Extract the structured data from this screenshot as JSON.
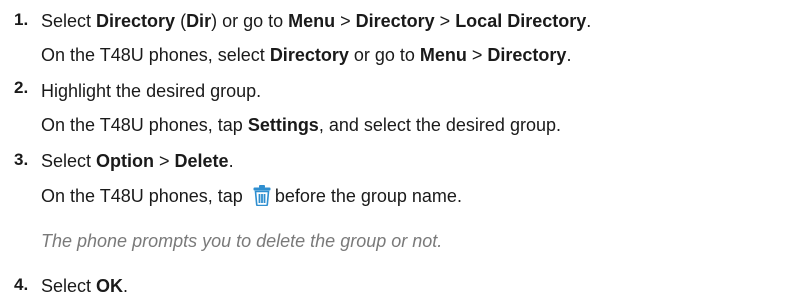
{
  "steps": [
    {
      "number": "1.",
      "line1": {
        "t1": "Select ",
        "b1": "Directory",
        "t2": " (",
        "b2": "Dir",
        "t3": ") or go to ",
        "b3": "Menu",
        "t4": " > ",
        "b4": "Directory",
        "t5": " > ",
        "b5": "Local Directory",
        "t6": "."
      },
      "line2": {
        "t1": "On the T48U phones, select ",
        "b1": "Directory",
        "t2": " or go to ",
        "b2": "Menu",
        "t3": " > ",
        "b3": "Directory",
        "t4": "."
      }
    },
    {
      "number": "2.",
      "line1": {
        "t1": "Highlight the desired group."
      },
      "line2": {
        "t1": "On the T48U phones, tap ",
        "b1": "Settings",
        "t2": ", and select the desired group."
      }
    },
    {
      "number": "3.",
      "line1": {
        "t1": "Select ",
        "b1": "Option",
        "t2": " > ",
        "b2": "Delete",
        "t3": "."
      },
      "line2": {
        "t1": "On the T48U phones, tap ",
        "icon": "trash-icon",
        "t2": "before the group name."
      },
      "note": "The phone prompts you to delete the group or not."
    },
    {
      "number": "4.",
      "line1": {
        "t1": "Select ",
        "b1": "OK",
        "t2": "."
      }
    }
  ],
  "colors": {
    "text": "#1a1a1a",
    "note": "#7a7a7a",
    "icon": "#2f8fd0"
  }
}
